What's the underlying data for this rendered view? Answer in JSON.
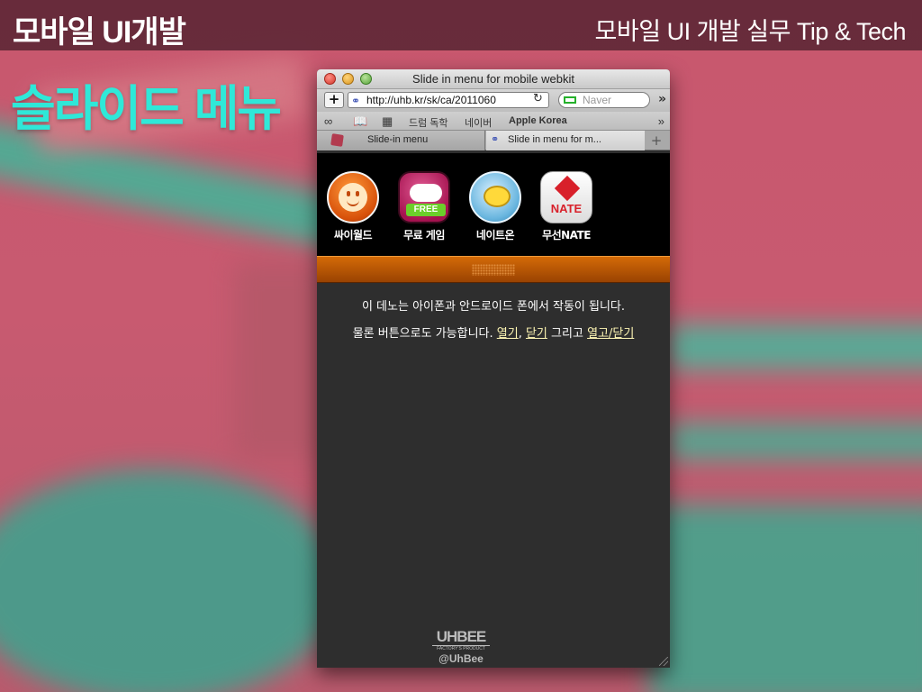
{
  "slide": {
    "header_left": "모바일 UI개발",
    "header_right": "모바일 UI 개발 실무 Tip & Tech",
    "title": "슬라이드 메뉴",
    "title_color": "#2fe8d8"
  },
  "browser": {
    "window_title": "Slide in menu for mobile webkit",
    "add_label": "+",
    "url": "http://uhb.kr/sk/ca/2011060",
    "search_placeholder": "Naver",
    "more_glyph": "»",
    "bookmarks": {
      "items": [
        "드럼 독학",
        "네이버",
        "Apple Korea"
      ],
      "overflow_glyph": "»"
    },
    "tabs": [
      {
        "label": "Slide-in menu",
        "active": false
      },
      {
        "label": "Slide in menu for m...",
        "active": true
      }
    ],
    "new_tab_glyph": "+"
  },
  "page": {
    "apps": [
      {
        "label": "싸이월드",
        "icon": "cyworld-icon"
      },
      {
        "label": "무료 게임",
        "icon": "game-controller-icon",
        "badge": "FREE"
      },
      {
        "label": "네이트온",
        "icon": "nateon-icon"
      },
      {
        "label": "무선NATE",
        "icon": "nate-icon",
        "badge": "NATE"
      }
    ],
    "handle_color": "#c45c05",
    "message_line1": "이 데노는 아이폰과 안드로이드 폰에서 작동이 됩니다.",
    "message_line2_prefix": "물론 버튼으로도 가능합니다.",
    "link_open": "열기",
    "sep1": ",",
    "link_close": "닫기",
    "connector": "그리고",
    "link_toggle": "열고/닫기"
  },
  "watermark": {
    "logo": "UHBEE",
    "subtitle": "FACTORY'S PRODUCT",
    "handle": "@UhBee"
  }
}
